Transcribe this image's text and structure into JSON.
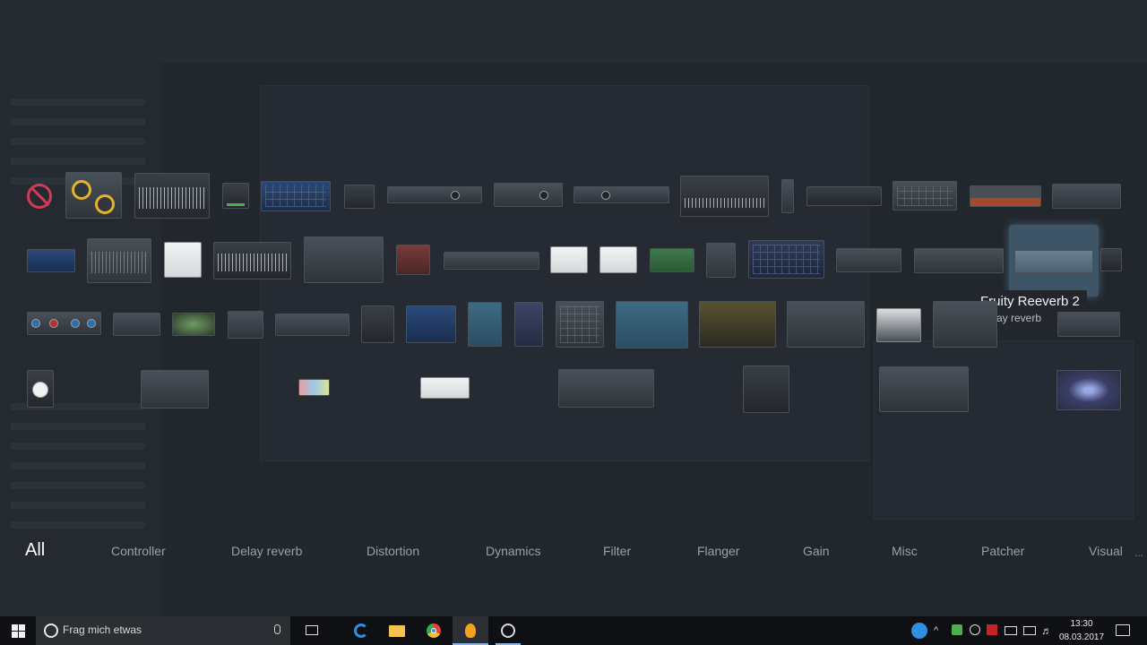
{
  "tooltip": {
    "title": "Fruity Reeverb 2",
    "category": "Delay reverb"
  },
  "categories": [
    {
      "label": "All",
      "active": true
    },
    {
      "label": "Controller"
    },
    {
      "label": "Delay reverb"
    },
    {
      "label": "Distortion"
    },
    {
      "label": "Dynamics"
    },
    {
      "label": "Filter"
    },
    {
      "label": "Flanger"
    },
    {
      "label": "Gain"
    },
    {
      "label": "Misc"
    },
    {
      "label": "Patcher"
    },
    {
      "label": "Visual"
    }
  ],
  "category_more": "...",
  "taskbar": {
    "search_placeholder": "Frag mich etwas",
    "time": "13:30",
    "date": "08.03.2017"
  },
  "icons": {
    "no_plugin": "no-plugin-icon",
    "start": "windows-start-icon",
    "cortana": "cortana-ring-icon",
    "microphone": "microphone-icon",
    "task_view": "task-view-icon",
    "edge": "edge-browser-icon",
    "explorer": "file-explorer-icon",
    "chrome": "chrome-icon",
    "fl_studio": "fl-studio-icon",
    "obs": "obs-icon"
  },
  "colors": {
    "accent": "#8ab4e0",
    "no_plugin_red": "#d23b57",
    "selected_highlight": "#3d5566"
  }
}
